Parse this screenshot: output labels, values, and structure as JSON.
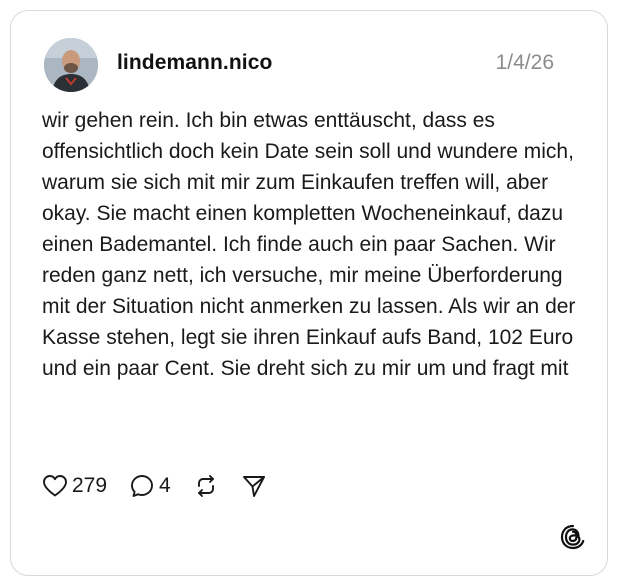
{
  "post": {
    "username": "lindemann.nico",
    "date": "1/4/26",
    "text": "wir gehen rein. Ich bin etwas enttäuscht, dass es offensichtlich doch kein Date sein soll und wundere mich, warum sie sich mit mir zum Einkaufen treffen will, aber okay. Sie macht einen kompletten Wocheneinkauf, dazu einen Bademantel. Ich finde auch ein paar Sachen. Wir reden ganz nett, ich versuche, mir meine Überforderung mit der Situation nicht anmerken zu lassen. Als wir an der Kasse stehen, legt sie ihren Einkauf aufs Band, 102 Euro und ein paar Cent. Sie dreht sich zu mir um und fragt mit"
  },
  "actions": {
    "like_count": "279",
    "reply_count": "4"
  },
  "icons": {
    "like": "heart-icon",
    "reply": "comment-bubble-icon",
    "repost": "repost-arrows-icon",
    "share": "paper-plane-icon",
    "brand": "threads-logo-icon"
  }
}
